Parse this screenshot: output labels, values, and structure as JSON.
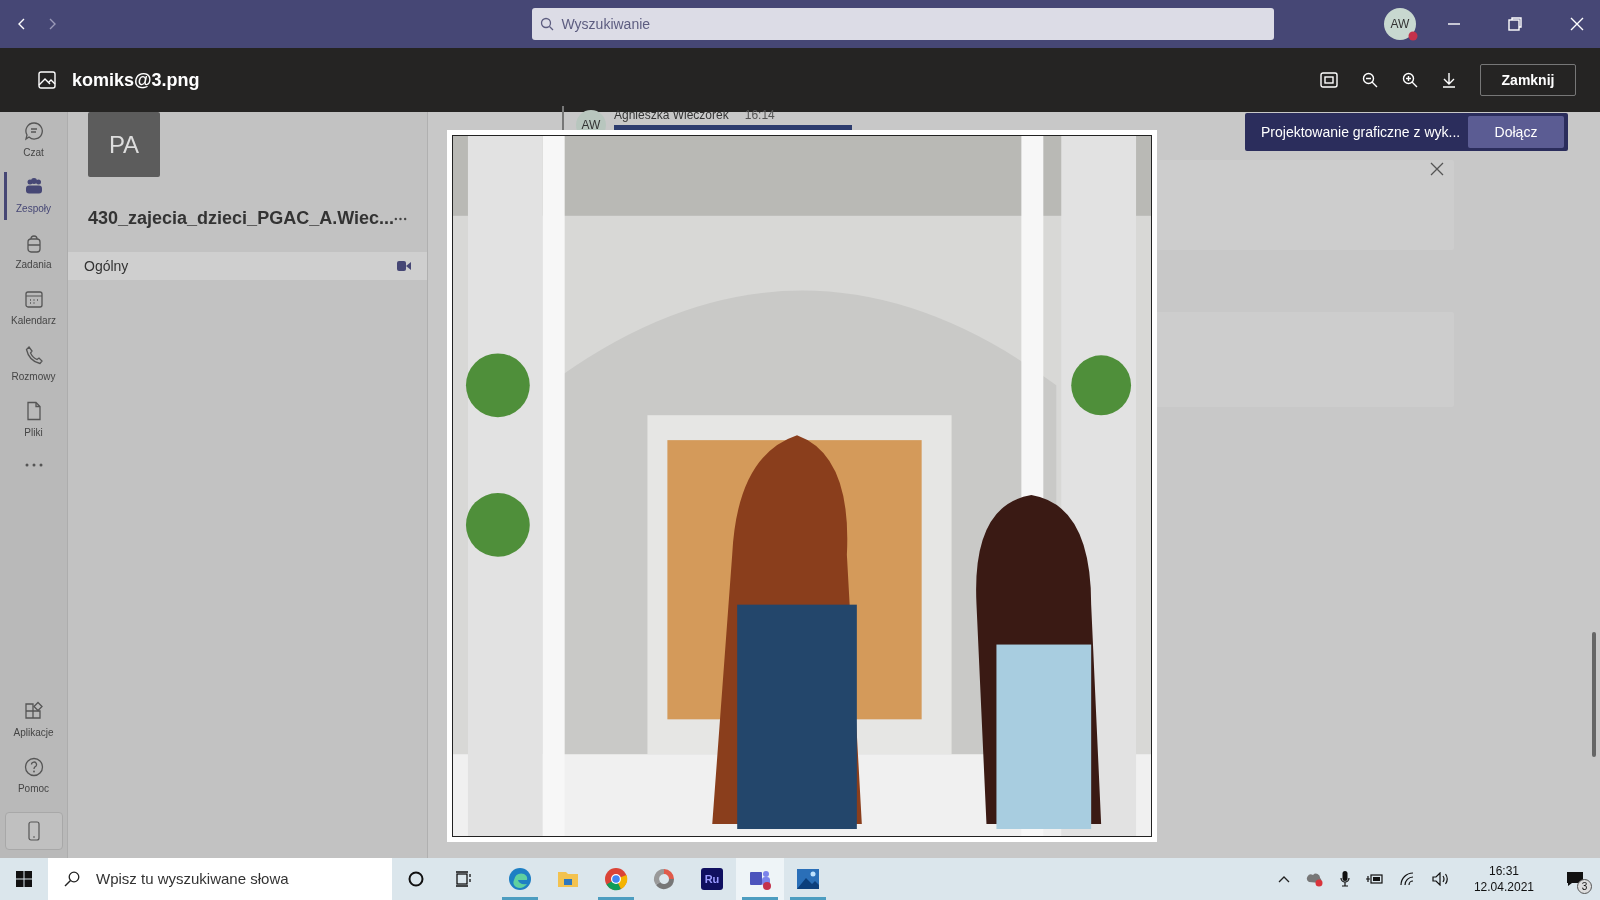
{
  "title_bar": {
    "search_placeholder": "Wyszukiwanie",
    "avatar": "AW"
  },
  "viewer": {
    "file_name": "komiks@3.png",
    "close_button": "Zamknij"
  },
  "rail": [
    {
      "kind": "chat",
      "label": "Czat",
      "selected": false
    },
    {
      "kind": "teams",
      "label": "Zespoły",
      "selected": true
    },
    {
      "kind": "tasks",
      "label": "Zadania",
      "selected": false
    },
    {
      "kind": "calendar",
      "label": "Kalendarz",
      "selected": false
    },
    {
      "kind": "calls",
      "label": "Rozmowy",
      "selected": false
    },
    {
      "kind": "files",
      "label": "Pliki",
      "selected": false
    }
  ],
  "rail_bottom": [
    {
      "kind": "apps",
      "label": "Aplikacje",
      "selected": false
    },
    {
      "kind": "help",
      "label": "Pomoc",
      "selected": false
    }
  ],
  "team": {
    "avatar": "PA",
    "name": "430_zajecia_dzieci_PGAC_A.Wiec..."
  },
  "channels": [
    {
      "name": "Ogólny",
      "selected": true
    }
  ],
  "message": {
    "avatar": "AW",
    "author": "Agnieszka Wieczorek",
    "time": "16:14"
  },
  "meeting_banner": {
    "title": "Projektowanie graficzne z wyk...",
    "button": "Dołącz"
  },
  "taskbar": {
    "search_placeholder": "Wpisz tu wyszukiwane słowa",
    "apps": [
      {
        "kind": "edge",
        "running": true,
        "active": false
      },
      {
        "kind": "explorer",
        "running": false,
        "active": false
      },
      {
        "kind": "chrome",
        "running": true,
        "active": false
      },
      {
        "kind": "orbit",
        "running": false,
        "active": false
      },
      {
        "kind": "ru",
        "label": "Ru",
        "running": false,
        "active": false
      },
      {
        "kind": "teams",
        "running": true,
        "active": true
      },
      {
        "kind": "photos",
        "running": true,
        "active": false
      }
    ],
    "time": "16:31",
    "date": "12.04.2021",
    "notification_count": "3"
  }
}
